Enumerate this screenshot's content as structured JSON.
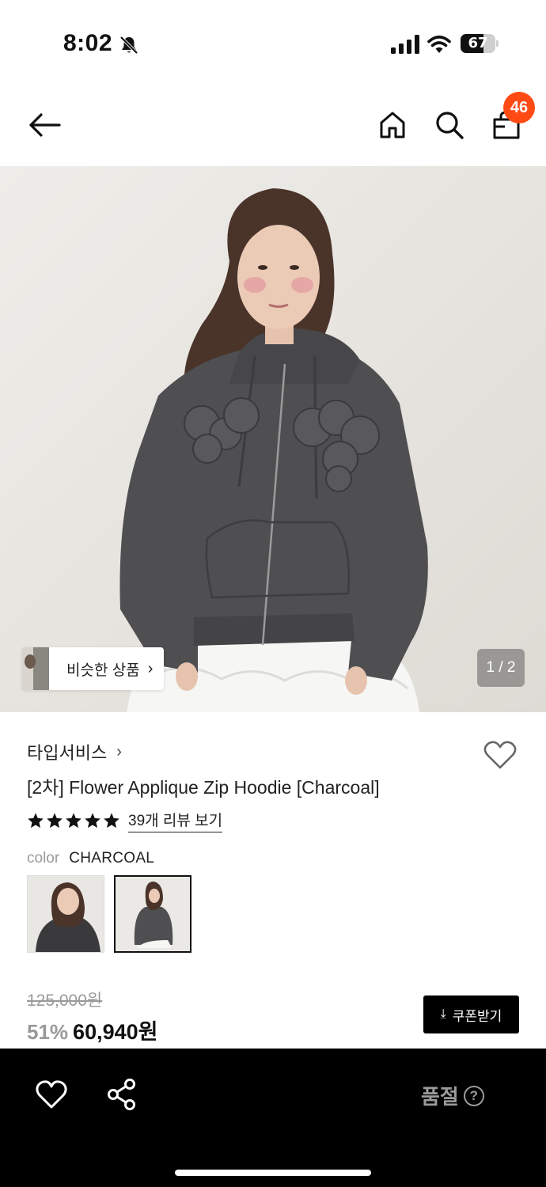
{
  "status_bar": {
    "time": "8:02",
    "battery_level": "67",
    "battery_fraction": 0.67
  },
  "nav": {
    "cart_count": "46"
  },
  "hero": {
    "similar_products_label": "비슷한 상품",
    "page_counter": "1 / 2"
  },
  "product": {
    "brand": "타입서비스",
    "title": "[2차] Flower Applique Zip Hoodie [Charcoal]",
    "rating_stars": 5,
    "review_link": "39개 리뷰 보기",
    "color_label": "color",
    "color_value": "CHARCOAL",
    "price_original": "125,000원",
    "discount": "51%",
    "price_sale": "60,940원",
    "coupon_button": "쿠폰받기"
  },
  "bottom_bar": {
    "status_label": "품절",
    "help_symbol": "?"
  },
  "colors": {
    "badge": "#ff4a14",
    "bottom_bar": "#000000",
    "muted_text": "#9a9a9a"
  }
}
